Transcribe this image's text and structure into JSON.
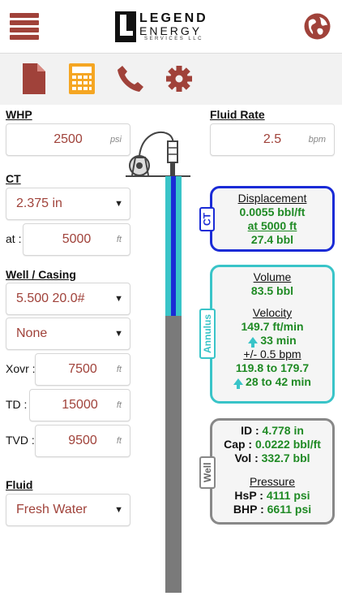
{
  "app": {
    "logo_line1": "LEGEND",
    "logo_line2": "ENERGY",
    "logo_line3": "SERVICES LLC"
  },
  "colors": {
    "accent": "#a0423a",
    "calc": "#f5a623",
    "ct": "#1a2bd6",
    "annulus": "#39c4c8",
    "well": "#888888",
    "value_green": "#1f8a24"
  },
  "toolbar": {
    "icons": [
      "document-icon",
      "calculator-icon",
      "phone-icon",
      "gear-icon"
    ]
  },
  "whp": {
    "label": "WHP",
    "value": "2500",
    "unit": "psi"
  },
  "fluid_rate": {
    "label": "Fluid Rate",
    "value": "2.5",
    "unit": "bpm"
  },
  "ct": {
    "label": "CT",
    "size": "2.375 in",
    "at_label": "at :",
    "at_value": "5000",
    "at_unit": "ft"
  },
  "well_casing": {
    "label": "Well / Casing",
    "casing": "5.500 20.0#",
    "liner": "None",
    "xovr_label": "Xovr :",
    "xovr_value": "7500",
    "xovr_unit": "ft",
    "td_label": "TD :",
    "td_value": "15000",
    "td_unit": "ft",
    "tvd_label": "TVD :",
    "tvd_value": "9500",
    "tvd_unit": "ft"
  },
  "fluid": {
    "label": "Fluid",
    "value": "Fresh Water"
  },
  "ct_panel": {
    "tag": "CT",
    "header": "Displacement",
    "value1": "0.0055 bbl/ft",
    "value2": "at 5000 ft",
    "value3": "27.4 bbl"
  },
  "annulus_panel": {
    "tag": "Annulus",
    "volume_header": "Volume",
    "volume_value": "83.5 bbl",
    "velocity_header": "Velocity",
    "velocity_value": "149.7 ft/min",
    "time_value": "33 min",
    "range_header": "+/- 0.5 bpm",
    "range_value": "119.8 to 179.7",
    "range_time": "28 to 42 min"
  },
  "well_panel": {
    "tag": "Well",
    "id_label": "ID : ",
    "id_value": "4.778 in",
    "cap_label": "Cap : ",
    "cap_value": "0.0222 bbl/ft",
    "vol_label": "Vol : ",
    "vol_value": "332.7 bbl",
    "pressure_header": "Pressure",
    "hsp_label": "HsP : ",
    "hsp_value": "4111 psi",
    "bhp_label": "BHP : ",
    "bhp_value": "6611 psi"
  }
}
